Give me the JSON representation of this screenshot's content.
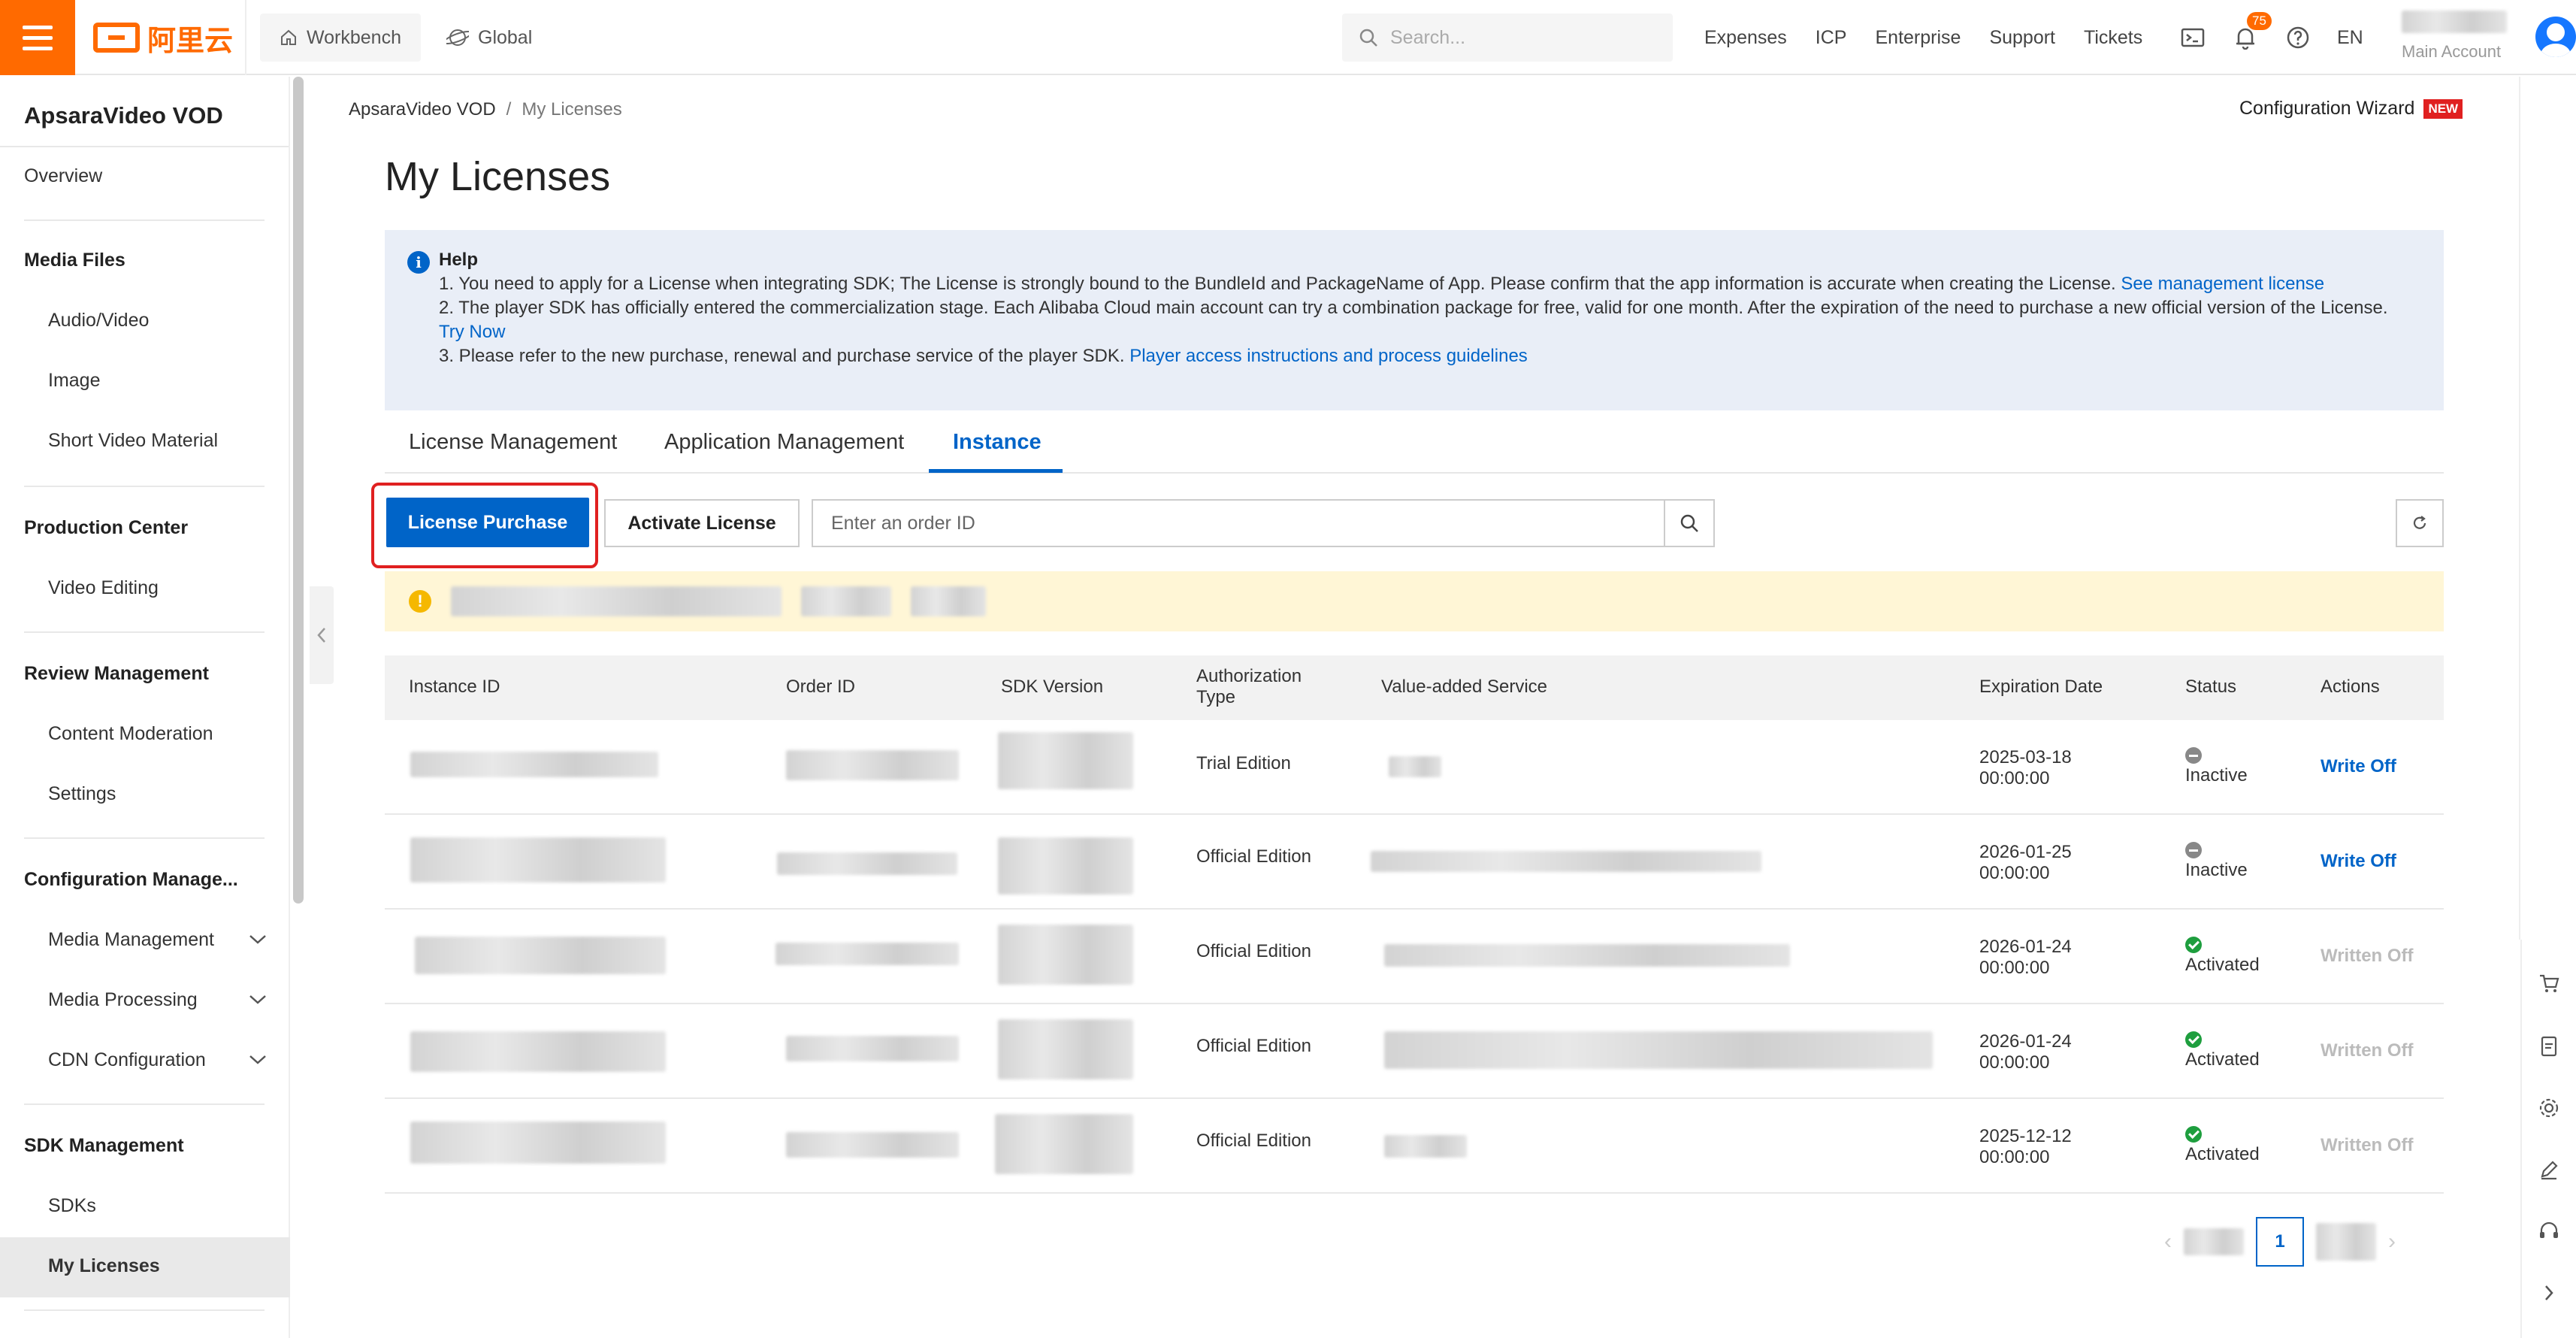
{
  "header": {
    "logo_text": "阿里云",
    "workbench": "Workbench",
    "global": "Global",
    "search_placeholder": "Search...",
    "nav": [
      "Expenses",
      "ICP",
      "Enterprise",
      "Support",
      "Tickets"
    ],
    "notification_count": "75",
    "lang": "EN",
    "account_label": "Main Account"
  },
  "sidebar": {
    "title": "ApsaraVideo VOD",
    "overview": "Overview",
    "media_files": "Media Files",
    "audio_video": "Audio/Video",
    "image": "Image",
    "short_video": "Short Video Material",
    "production_center": "Production Center",
    "video_editing": "Video Editing",
    "review_management": "Review Management",
    "content_moderation": "Content Moderation",
    "settings": "Settings",
    "config_management": "Configuration Manage...",
    "media_management": "Media Management",
    "media_processing": "Media Processing",
    "cdn_configuration": "CDN Configuration",
    "sdk_management": "SDK Management",
    "sdks": "SDKs",
    "my_licenses": "My Licenses"
  },
  "breadcrumb": {
    "root": "ApsaraVideo VOD",
    "sep": "/",
    "current": "My Licenses"
  },
  "wizard": {
    "label": "Configuration Wizard",
    "tag": "NEW"
  },
  "page": {
    "title": "My Licenses"
  },
  "help": {
    "title": "Help",
    "line1": "1. You need to apply for a License when integrating SDK; The License is strongly bound to the BundleId and PackageName of App. Please confirm that the app information is accurate when creating the License.",
    "line1_link": "See management license",
    "line2": "2. The player SDK has officially entered the commercialization stage. Each Alibaba Cloud main account can try a combination package for free, valid for one month. After the expiration of the need to purchase a new official version of the License.",
    "line2_link": "Try Now",
    "line3": "3. Please refer to the new purchase, renewal and purchase service of the player SDK.",
    "line3_link": "Player access instructions and process guidelines"
  },
  "tabs": [
    "License Management",
    "Application Management",
    "Instance"
  ],
  "toolbar": {
    "purchase": "License Purchase",
    "activate": "Activate License",
    "order_placeholder": "Enter an order ID"
  },
  "table": {
    "columns": [
      "Instance ID",
      "Order ID",
      "SDK Version",
      "Authorization Type",
      "Value-added Service",
      "Expiration Date",
      "Status",
      "Actions"
    ],
    "rows": [
      {
        "auth_type": "Trial Edition",
        "expiry_date": "2025-03-18",
        "expiry_time": "00:00:00",
        "status": "Inactive",
        "status_kind": "inactive",
        "action": "Write Off",
        "action_enabled": true
      },
      {
        "auth_type": "Official Edition",
        "expiry_date": "2026-01-25",
        "expiry_time": "00:00:00",
        "status": "Inactive",
        "status_kind": "inactive",
        "action": "Write Off",
        "action_enabled": true
      },
      {
        "auth_type": "Official Edition",
        "expiry_date": "2026-01-24",
        "expiry_time": "00:00:00",
        "status": "Activated",
        "status_kind": "active",
        "action": "Written Off",
        "action_enabled": false
      },
      {
        "auth_type": "Official Edition",
        "expiry_date": "2026-01-24",
        "expiry_time": "00:00:00",
        "status": "Activated",
        "status_kind": "active",
        "action": "Written Off",
        "action_enabled": false
      },
      {
        "auth_type": "Official Edition",
        "expiry_date": "2025-12-12",
        "expiry_time": "00:00:00",
        "status": "Activated",
        "status_kind": "active",
        "action": "Written Off",
        "action_enabled": false
      }
    ]
  },
  "pagination": {
    "current": "1"
  },
  "colors": {
    "brand": "#ff6a00",
    "primary": "#0064c8",
    "highlight": "#e02020",
    "success": "#1e9e3e"
  }
}
